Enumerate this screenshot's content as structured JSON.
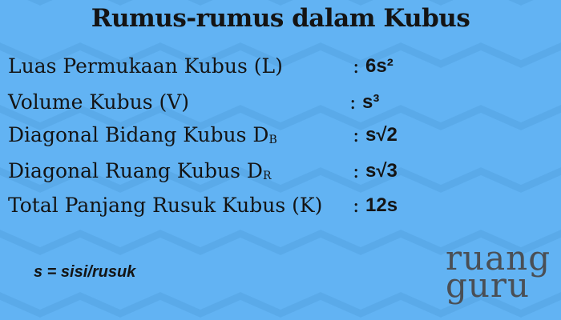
{
  "title": "Rumus-rumus dalam Kubus",
  "formulas": [
    {
      "label": "Luas Permukaan Kubus (L)",
      "sub": "",
      "value": "6s²"
    },
    {
      "label": "Volume Kubus (V)",
      "sub": "",
      "value": "s³"
    },
    {
      "label": "Diagonal Bidang Kubus D",
      "sub": "B",
      "value": "s√2"
    },
    {
      "label": "Diagonal Ruang Kubus D",
      "sub": "R",
      "value": "s√3"
    },
    {
      "label": "Total Panjang Rusuk Kubus (K)",
      "sub": "",
      "value": "12s"
    }
  ],
  "colon": ":",
  "note": "s = sisi/rusuk",
  "logo": {
    "line1": "ruang",
    "line2": "guru"
  },
  "colors": {
    "background": "#62b3f3",
    "zigzag": "#5aaae9",
    "text": "#141414",
    "logo": "#4a4f55"
  }
}
